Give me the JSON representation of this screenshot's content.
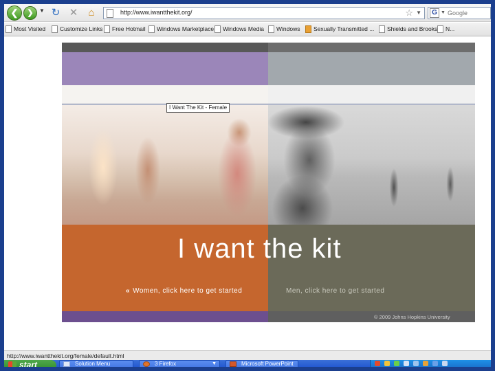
{
  "browser": {
    "url": "http://www.iwantthekit.org/",
    "search_placeholder": "Google",
    "google_label": "G",
    "bookmarks": [
      {
        "label": "Most Visited",
        "icon": "page-icon"
      },
      {
        "label": "Customize Links",
        "icon": "page-icon"
      },
      {
        "label": "Free Hotmail",
        "icon": "page-icon"
      },
      {
        "label": "Windows Marketplace",
        "icon": "page-icon"
      },
      {
        "label": "Windows Media",
        "icon": "page-icon"
      },
      {
        "label": "Windows",
        "icon": "page-icon"
      },
      {
        "label": "Sexually Transmitted ...",
        "icon": "rss-icon"
      },
      {
        "label": "Shields and Brooks ...",
        "icon": "page-icon"
      },
      {
        "label": "N...",
        "icon": "page-icon"
      }
    ],
    "status": "http://www.iwantthekit.org/female/default.html"
  },
  "page": {
    "tooltip": "I Want The Kit - Female",
    "headline": "I want the kit",
    "women_link_chevron": "«",
    "women_link": "Women, click here to get started",
    "men_link": "Men, click here to get started",
    "copyright": "© 2009 Johns Hopkins University",
    "colors": {
      "women_panel": "#c5662e",
      "men_panel": "#6b6a59",
      "women_band": "#9b86b9",
      "men_band": "#a2a8ad"
    }
  },
  "taskbar": {
    "start_label": "start",
    "tasks": [
      {
        "label": "Solution Menu"
      },
      {
        "label": "3 Firefox"
      },
      {
        "label": "Microsoft PowerPoint"
      }
    ]
  }
}
